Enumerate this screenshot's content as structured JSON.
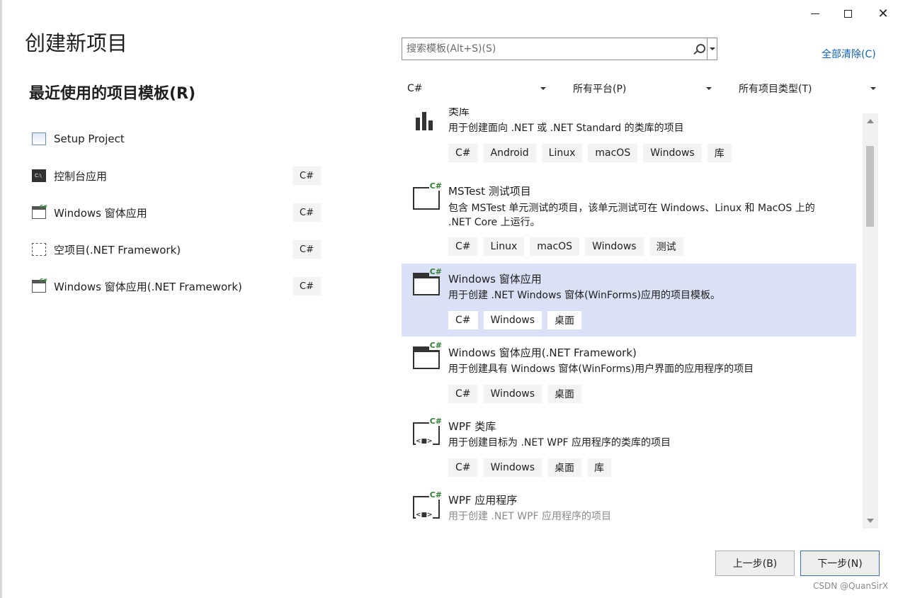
{
  "window": {
    "title": "创建新项目",
    "controls": [
      "minimize",
      "maximize",
      "close"
    ]
  },
  "recent": {
    "heading": "最近使用的项目模板(R)",
    "items": [
      {
        "label": "Setup Project",
        "icon": "setup-project-icon",
        "badge": ""
      },
      {
        "label": "控制台应用",
        "icon": "console-app-icon",
        "badge": "C#"
      },
      {
        "label": "Windows 窗体应用",
        "icon": "windows-forms-icon",
        "badge": "C#"
      },
      {
        "label": "空项目(.NET Framework)",
        "icon": "empty-project-icon",
        "badge": "C#"
      },
      {
        "label": "Windows 窗体应用(.NET Framework)",
        "icon": "windows-forms-icon",
        "badge": "C#"
      }
    ]
  },
  "search": {
    "placeholder": "搜索模板(Alt+S)(S)",
    "value": ""
  },
  "clear_all": "全部清除(C)",
  "filters": {
    "language": "C#",
    "platform": "所有平台(P)",
    "project_type": "所有项目类型(T)"
  },
  "templates": [
    {
      "name": "类库",
      "desc": "用于创建面向 .NET 或 .NET Standard 的类库的项目",
      "tags": [
        "C#",
        "Android",
        "Linux",
        "macOS",
        "Windows",
        "库"
      ],
      "icon": "class-library-icon",
      "selected": false
    },
    {
      "name": "MSTest 测试项目",
      "desc": "包含 MSTest 单元测试的项目，该单元测试可在 Windows、Linux 和 MacOS 上的 .NET Core 上运行。",
      "tags": [
        "C#",
        "Linux",
        "macOS",
        "Windows",
        "测试"
      ],
      "icon": "mstest-icon",
      "selected": false
    },
    {
      "name": "Windows 窗体应用",
      "desc": "用于创建 .NET Windows 窗体(WinForms)应用的项目模板。",
      "tags": [
        "C#",
        "Windows",
        "桌面"
      ],
      "icon": "windows-forms-icon",
      "selected": true
    },
    {
      "name": "Windows 窗体应用(.NET Framework)",
      "desc": "用于创建具有 Windows 窗体(WinForms)用户界面的应用程序的项目",
      "tags": [
        "C#",
        "Windows",
        "桌面"
      ],
      "icon": "windows-forms-icon",
      "selected": false
    },
    {
      "name": "WPF 类库",
      "desc": "用于创建目标为 .NET WPF 应用程序的类库的项目",
      "tags": [
        "C#",
        "Windows",
        "桌面",
        "库"
      ],
      "icon": "wpf-library-icon",
      "selected": false
    },
    {
      "name": "WPF 应用程序",
      "desc": "用于创建 .NET WPF 应用程序的项目",
      "tags": [],
      "icon": "wpf-app-icon",
      "selected": false
    }
  ],
  "buttons": {
    "back": "上一步(B)",
    "next": "下一步(N)"
  },
  "watermark": "CSDN @QuanSirX",
  "colors": {
    "selected_bg": "#dae0f6",
    "link": "#0e62b8",
    "tag_bg": "#f3f3f3",
    "csharp_green": "#2e7d32"
  }
}
